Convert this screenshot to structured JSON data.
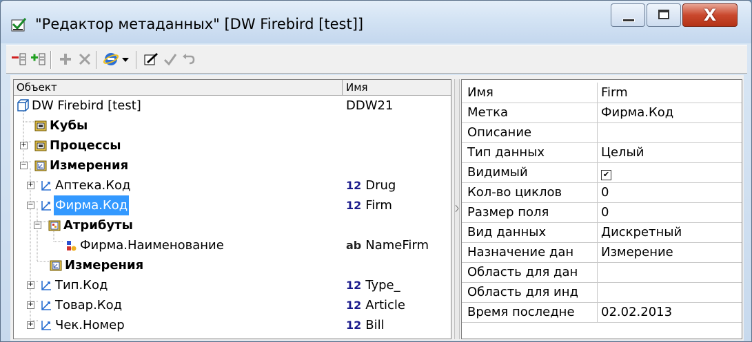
{
  "window": {
    "title": "\"Редактор метаданных\" [DW Firebird [test]]",
    "close_glyph": "X"
  },
  "tree": {
    "header_object": "Объект",
    "header_name": "Имя",
    "rows": [
      {
        "label": "DW Firebird [test]",
        "name": "DDW21",
        "badge": ""
      },
      {
        "label": "Кубы"
      },
      {
        "label": "Процессы"
      },
      {
        "label": "Измерения"
      },
      {
        "label": "Аптека.Код",
        "badge": "12",
        "name": "Drug"
      },
      {
        "label": "Фирма.Код",
        "badge": "12",
        "name": "Firm"
      },
      {
        "label": "Атрибуты"
      },
      {
        "label": "Фирма.Наименование",
        "badge": "ab",
        "name": "NameFirm"
      },
      {
        "label": "Измерения"
      },
      {
        "label": "Тип.Код",
        "badge": "12",
        "name": "Type_"
      },
      {
        "label": "Товар.Код",
        "badge": "12",
        "name": "Article"
      },
      {
        "label": "Чек.Номер",
        "badge": "12",
        "name": "Bill"
      }
    ]
  },
  "properties": [
    {
      "key": "Имя",
      "value": "Firm"
    },
    {
      "key": "Метка",
      "value": "Фирма.Код"
    },
    {
      "key": "Описание",
      "value": ""
    },
    {
      "key": "Тип данных",
      "value": "Целый"
    },
    {
      "key": "Видимый",
      "value": "",
      "checkbox": true
    },
    {
      "key": "Кол-во циклов",
      "value": "0"
    },
    {
      "key": "Размер поля",
      "value": "0"
    },
    {
      "key": "Вид данных",
      "value": "Дискретный"
    },
    {
      "key": "Назначение дан",
      "value": "Измерение"
    },
    {
      "key": "Область для дан",
      "value": ""
    },
    {
      "key": "Область для инд",
      "value": ""
    },
    {
      "key": "Время последне",
      "value": "02.02.2013"
    }
  ],
  "colors": {
    "selection": "#3399ff",
    "folder": "#d9b63a",
    "dimension": "#2a6fd0"
  }
}
